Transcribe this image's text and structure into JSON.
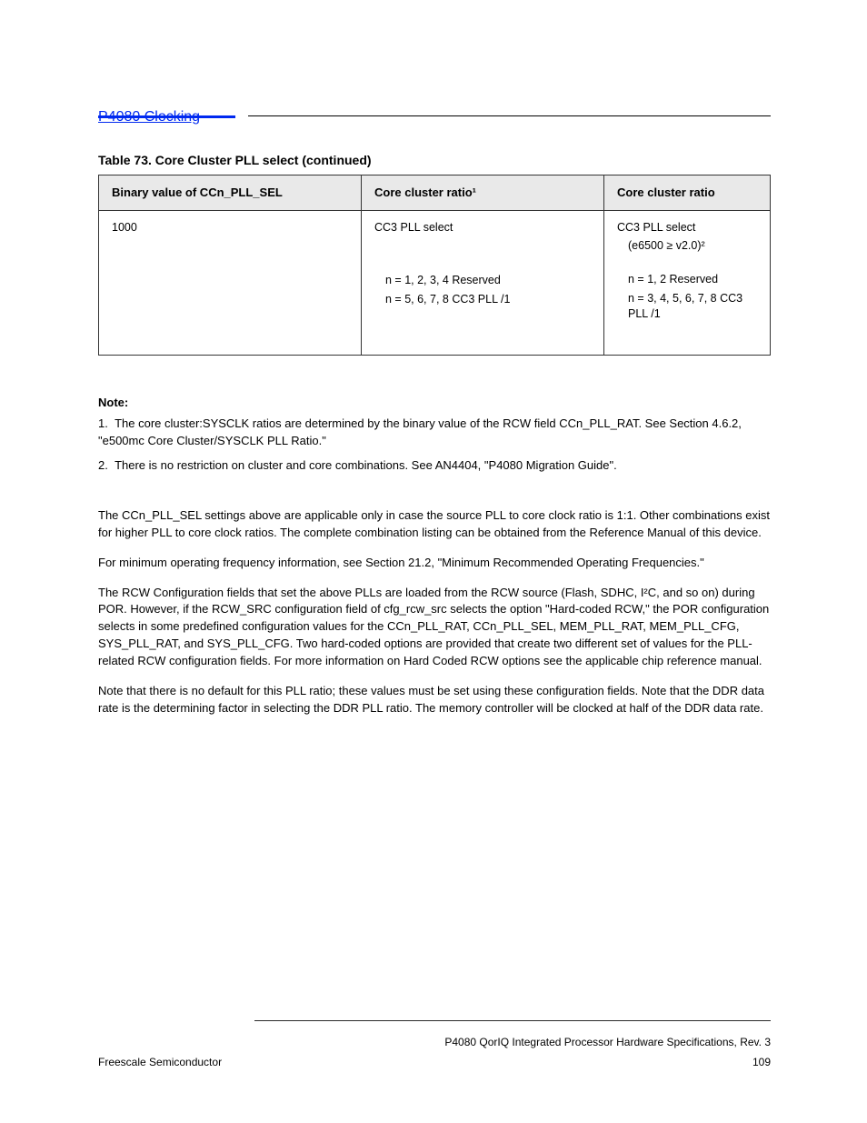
{
  "header": {
    "running_head_link": "P4080 Clocking"
  },
  "table": {
    "caption": "Table 73. Core Cluster PLL select (continued)",
    "headers": [
      "Binary value of CCn_PLL_SEL",
      "Core cluster ratio¹",
      "Core cluster ratio"
    ],
    "rows": [
      {
        "c0": {
          "lines": [
            "1000"
          ]
        },
        "c1": {
          "title": "CC3 PLL select",
          "lines": [
            "n = 1, 2, 3, 4 Reserved",
            "n = 5, 6, 7, 8 CC3 PLL /1"
          ]
        },
        "c2": {
          "title": "CC3 PLL select",
          "sub": "(e6500 ≥ v2.0)²",
          "lines": [
            "n = 1, 2 Reserved",
            "n = 3, 4, 5, 6, 7, 8 CC3 PLL /1"
          ]
        }
      }
    ],
    "notes": [
      "The core cluster:SYSCLK ratios are determined by the binary value of the RCW field CCn_PLL_RAT. See Section 4.6.2, \"e500mc Core Cluster/SYSCLK PLL Ratio.\"",
      "There is no restriction on cluster and core combinations. See AN4404, \"P4080 Migration Guide\"."
    ]
  },
  "paragraphs": [
    "The CCn_PLL_SEL settings above are applicable only in case the source PLL to core clock ratio is 1:1. Other combinations exist for higher PLL to core clock ratios. The complete combination listing can be obtained from the Reference Manual of this device.",
    "For minimum operating frequency information, see Section 21.2, \"Minimum Recommended Operating Frequencies.\"",
    "The RCW Configuration fields that set the above PLLs are loaded from the RCW source (Flash, SDHC, I²C, and so on) during POR. However, if the RCW_SRC configuration field of cfg_rcw_src selects the option \"Hard-coded RCW,\" the POR configuration selects in some predefined configuration values for the CCn_PLL_RAT, CCn_PLL_SEL, MEM_PLL_RAT, MEM_PLL_CFG, SYS_PLL_RAT, and SYS_PLL_CFG. Two hard-coded options are provided that create two different set of values for the PLL-related RCW configuration fields. For more information on Hard Coded RCW options see the applicable chip reference manual.",
    "Note that there is no default for this PLL ratio; these values must be set using these configuration fields. Note that the DDR data rate is the determining factor in selecting the DDR PLL ratio. The memory controller will be clocked at half of the DDR data rate."
  ],
  "footer": {
    "doc_title": "P4080 QorIQ Integrated Processor Hardware Specifications, Rev. 3",
    "company": "Freescale Semiconductor",
    "page": "109"
  }
}
